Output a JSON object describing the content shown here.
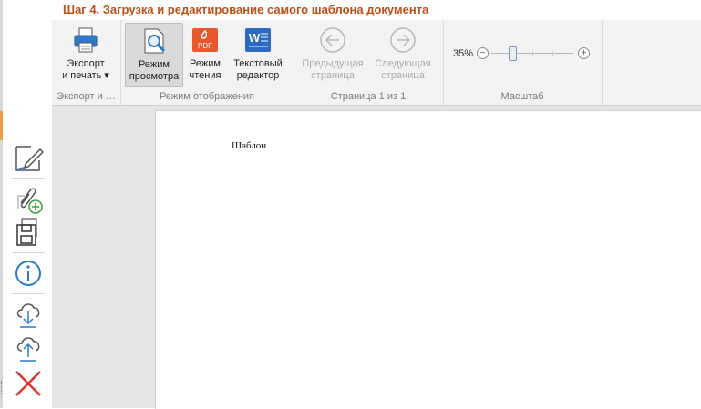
{
  "window": {
    "title": "Шаг 4. Загрузка и редактирование самого шаблона документа"
  },
  "ribbon": {
    "export_group": {
      "label": "Экспорт и …",
      "export_button": {
        "line1": "Экспорт",
        "line2": "и печать ▾",
        "icon": "printer-icon"
      }
    },
    "view_mode_group": {
      "label": "Режим отображения",
      "buttons": [
        {
          "line1": "Режим",
          "line2": "просмотра",
          "icon": "magnifier-document-icon",
          "active": true
        },
        {
          "line1": "Режим",
          "line2": "чтения",
          "icon": "pdf-icon",
          "badge": "PDF"
        },
        {
          "line1": "Текстовый",
          "line2": "редактор",
          "icon": "word-icon",
          "badge": "W"
        }
      ]
    },
    "page_group": {
      "label": "Страница 1 из 1",
      "prev": {
        "line1": "Предыдущая",
        "line2": "страница",
        "icon": "arrow-left-circle-icon"
      },
      "next": {
        "line1": "Следующая",
        "line2": "страница",
        "icon": "arrow-right-circle-icon"
      }
    },
    "zoom_group": {
      "label": "Масштаб",
      "percent": "35%",
      "minus": "−",
      "plus": "+",
      "zoom_level_fraction": 0.3
    }
  },
  "sidebar": {
    "buttons": [
      {
        "name": "edit-document-icon"
      },
      {
        "name": "attach-add-icon"
      },
      {
        "name": "save-icon"
      },
      {
        "name": "info-icon"
      },
      {
        "name": "cloud-download-icon"
      },
      {
        "name": "cloud-upload-icon"
      },
      {
        "name": "delete-icon"
      }
    ]
  },
  "document": {
    "text": "Шаблон"
  },
  "colors": {
    "title": "#c0501a",
    "accent_blue": "#2e78c8",
    "delete_red": "#e03030",
    "pdf_orange": "#e8582a",
    "word_blue": "#2b6ac4"
  }
}
